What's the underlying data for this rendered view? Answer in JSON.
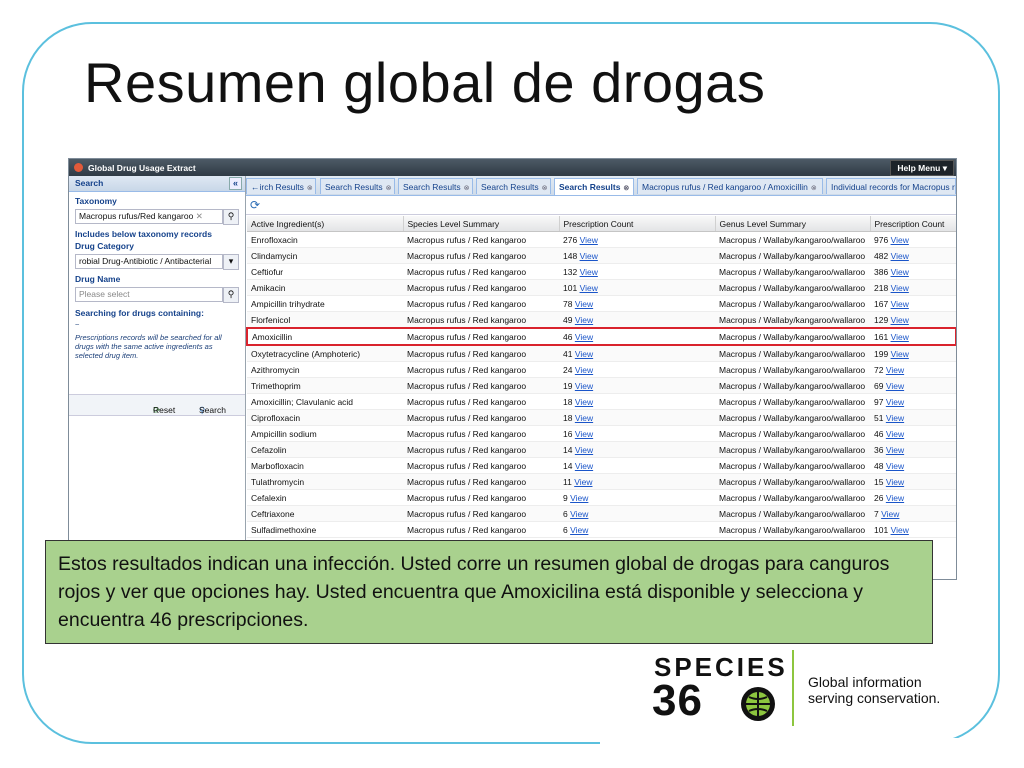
{
  "slide": {
    "title": "Resumen global de drogas"
  },
  "app": {
    "title": "Global Drug Usage Extract",
    "help_menu": "Help Menu ▾"
  },
  "sidebar": {
    "header": "Search",
    "collapse": "«",
    "taxonomy_label": "Taxonomy",
    "taxonomy_value": "Macropus rufus/Red kangaroo",
    "include_below": "Includes below taxonomy records",
    "drug_category_label": "Drug Category",
    "drug_category_value": "robial Drug-Antibiotic / Antibacterial",
    "drug_name_label": "Drug Name",
    "drug_name_placeholder": "Please select",
    "searching_label": "Searching for drugs containing:",
    "searching_value": "~",
    "hint": "Prescriptions records will be searched for all drugs with the same active ingredients as selected drug item.",
    "reset_label": "Reset",
    "search_label": "Search"
  },
  "tabs": [
    {
      "label": "irch Results"
    },
    {
      "label": "Search Results"
    },
    {
      "label": "Search Results"
    },
    {
      "label": "Search Results"
    },
    {
      "label": "Search Results"
    },
    {
      "label": "Macropus rufus / Red kangaroo / Amoxicillin"
    },
    {
      "label": "Individual records for Macropus r"
    }
  ],
  "grid": {
    "columns": [
      "Active Ingredient(s)",
      "Species Level Summary",
      "Prescription Count",
      "Genus Level Summary",
      "Prescription Count"
    ],
    "view_label": "View",
    "rows": [
      {
        "ingredient": "Enrofloxacin",
        "species": "Macropus rufus / Red kangaroo",
        "count": "276",
        "genus": "Macropus / Wallaby/kangaroo/wallaroo",
        "gcount": "976"
      },
      {
        "ingredient": "Clindamycin",
        "species": "Macropus rufus / Red kangaroo",
        "count": "148",
        "genus": "Macropus / Wallaby/kangaroo/wallaroo",
        "gcount": "482"
      },
      {
        "ingredient": "Ceftiofur",
        "species": "Macropus rufus / Red kangaroo",
        "count": "132",
        "genus": "Macropus / Wallaby/kangaroo/wallaroo",
        "gcount": "386"
      },
      {
        "ingredient": "Amikacin",
        "species": "Macropus rufus / Red kangaroo",
        "count": "101",
        "genus": "Macropus / Wallaby/kangaroo/wallaroo",
        "gcount": "218"
      },
      {
        "ingredient": "Ampicillin trihydrate",
        "species": "Macropus rufus / Red kangaroo",
        "count": "78",
        "genus": "Macropus / Wallaby/kangaroo/wallaroo",
        "gcount": "167"
      },
      {
        "ingredient": "Florfenicol",
        "species": "Macropus rufus / Red kangaroo",
        "count": "49",
        "genus": "Macropus / Wallaby/kangaroo/wallaroo",
        "gcount": "129"
      },
      {
        "ingredient": "Amoxicillin",
        "species": "Macropus rufus / Red kangaroo",
        "count": "46",
        "genus": "Macropus / Wallaby/kangaroo/wallaroo",
        "gcount": "161"
      },
      {
        "ingredient": "Oxytetracycline (Amphoteric)",
        "species": "Macropus rufus / Red kangaroo",
        "count": "41",
        "genus": "Macropus / Wallaby/kangaroo/wallaroo",
        "gcount": "199"
      },
      {
        "ingredient": "Azithromycin",
        "species": "Macropus rufus / Red kangaroo",
        "count": "24",
        "genus": "Macropus / Wallaby/kangaroo/wallaroo",
        "gcount": "72"
      },
      {
        "ingredient": "Trimethoprim",
        "species": "Macropus rufus / Red kangaroo",
        "count": "19",
        "genus": "Macropus / Wallaby/kangaroo/wallaroo",
        "gcount": "69"
      },
      {
        "ingredient": "Amoxicillin; Clavulanic acid",
        "species": "Macropus rufus / Red kangaroo",
        "count": "18",
        "genus": "Macropus / Wallaby/kangaroo/wallaroo",
        "gcount": "97"
      },
      {
        "ingredient": "Ciprofloxacin",
        "species": "Macropus rufus / Red kangaroo",
        "count": "18",
        "genus": "Macropus / Wallaby/kangaroo/wallaroo",
        "gcount": "51"
      },
      {
        "ingredient": "Ampicillin sodium",
        "species": "Macropus rufus / Red kangaroo",
        "count": "16",
        "genus": "Macropus / Wallaby/kangaroo/wallaroo",
        "gcount": "46"
      },
      {
        "ingredient": "Cefazolin",
        "species": "Macropus rufus / Red kangaroo",
        "count": "14",
        "genus": "Macropus / Wallaby/kangaroo/wallaroo",
        "gcount": "36"
      },
      {
        "ingredient": "Marbofloxacin",
        "species": "Macropus rufus / Red kangaroo",
        "count": "14",
        "genus": "Macropus / Wallaby/kangaroo/wallaroo",
        "gcount": "48"
      },
      {
        "ingredient": "Tulathromycin",
        "species": "Macropus rufus / Red kangaroo",
        "count": "11",
        "genus": "Macropus / Wallaby/kangaroo/wallaroo",
        "gcount": "15"
      },
      {
        "ingredient": "Cefalexin",
        "species": "Macropus rufus / Red kangaroo",
        "count": "9",
        "genus": "Macropus / Wallaby/kangaroo/wallaroo",
        "gcount": "26"
      },
      {
        "ingredient": "Ceftriaxone",
        "species": "Macropus rufus / Red kangaroo",
        "count": "6",
        "genus": "Macropus / Wallaby/kangaroo/wallaroo",
        "gcount": "7"
      },
      {
        "ingredient": "Sulfadimethoxine",
        "species": "Macropus rufus / Red kangaroo",
        "count": "6",
        "genus": "Macropus / Wallaby/kangaroo/wallaroo",
        "gcount": "101"
      }
    ],
    "selected_row": 6
  },
  "callout": {
    "text": "Estos resultados indican una infección. Usted corre un resumen global de drogas para canguros rojos y ver que opciones hay. Usted encuentra que Amoxicilina está disponible  y selecciona y encuentra 46 prescripciones."
  },
  "logo": {
    "species": "SPECIES",
    "number": "36",
    "tagline_1": "Global information",
    "tagline_2": "serving conservation."
  },
  "colors": {
    "frame": "#5bc0de",
    "callout_bg": "#a9d18e",
    "selection_border": "#d9232d",
    "logo_accent": "#8dc63f",
    "link": "#1a55c9"
  },
  "icons": {
    "app": "app-logo-icon",
    "refresh": "refresh-icon",
    "reset": "reset-icon",
    "search": "magnifier-icon",
    "globe": "globe-icon"
  }
}
